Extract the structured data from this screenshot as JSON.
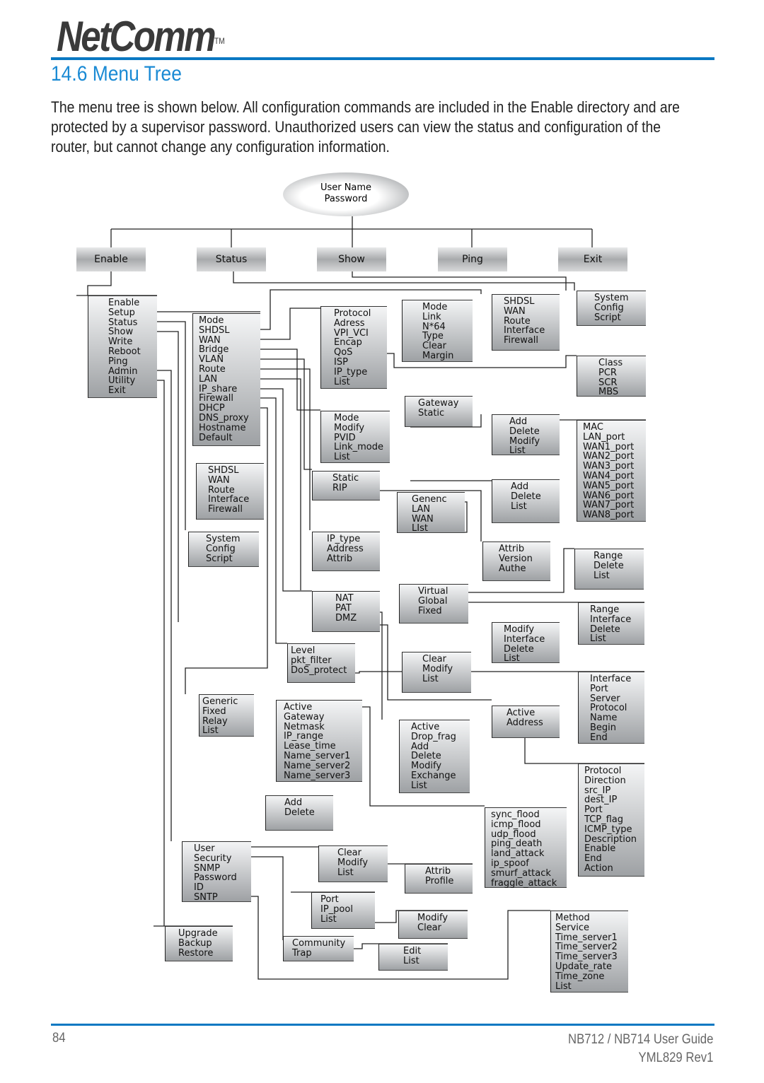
{
  "header": {
    "logo": "NetComm",
    "logo_tm": "TM",
    "accent": "#0a78c2"
  },
  "section_title": "14.6 Menu Tree",
  "intro": "The menu tree is shown below.  All configuration commands are included in the Enable directory and are protected by a supervisor password. Unauthorized users can view the status and configuration of the router, but cannot change any configuration information.",
  "diagram": {
    "root": [
      "User Name",
      "Password"
    ],
    "top_level": [
      "Enable",
      "Status",
      "Show",
      "Ping",
      "Exit"
    ],
    "boxes": [
      [
        "Enable",
        "Setup",
        "Status",
        "Show",
        "Write",
        "Reboot",
        "Ping",
        "Admin",
        "Utility",
        "Exit"
      ],
      [
        "Mode",
        "SHDSL",
        "WAN",
        "Bridge",
        "VLAN",
        "Route",
        "LAN",
        "IP_share",
        "Firewall",
        "DHCP",
        "DNS_proxy",
        "Hostname",
        "Default"
      ],
      [
        "Protocol",
        "Adress",
        "VPI_VCI",
        "Encap",
        "QoS",
        "ISP",
        "IP_type",
        "List"
      ],
      [
        "Mode",
        "Link",
        "N*64",
        "Type",
        "Clear",
        "Margin"
      ],
      [
        "SHDSL",
        "WAN",
        "Route",
        "Interface",
        "Firewall"
      ],
      [
        "System",
        "Config",
        "Script"
      ],
      [
        "Class",
        "PCR",
        "SCR",
        "MBS"
      ],
      [
        "Mode",
        "Modify",
        "PVID",
        "Link_mode",
        "List"
      ],
      [
        "Gateway",
        "Static"
      ],
      [
        "Add",
        "Delete",
        "Modify",
        "List"
      ],
      [
        "MAC",
        "LAN_port",
        "WAN1_port",
        "WAN2_port",
        "WAN3_port",
        "WAN4_port",
        "WAN5_port",
        "WAN6_port",
        "WAN7_port",
        "WAN8_port"
      ],
      [
        "Static",
        "RIP"
      ],
      [
        "Genenc",
        "LAN",
        "WAN",
        "LIst"
      ],
      [
        "Add",
        "Delete",
        "List"
      ],
      [
        "Attrib",
        "Version",
        "Authe"
      ],
      [
        "SHDSL",
        "WAN",
        "Route",
        "Interface",
        "Firewall"
      ],
      [
        "System",
        "Config",
        "Script"
      ],
      [
        "IP_type",
        "Address",
        "Attrib"
      ],
      [
        "Range",
        "Delete",
        "List"
      ],
      [
        "NAT",
        "PAT",
        "DMZ"
      ],
      [
        "Virtual",
        "Global",
        "Fixed"
      ],
      [
        "Range",
        "Interface",
        "Delete",
        "List"
      ],
      [
        "Modify",
        "Interface",
        "Delete",
        "List"
      ],
      [
        "Level",
        "pkt_filter",
        "DoS_protect"
      ],
      [
        "Clear",
        "Modify",
        "List"
      ],
      [
        "Interface",
        "Port",
        "Server",
        "Protocol",
        "Name",
        "Begin",
        "End"
      ],
      [
        "Generic",
        "Fixed",
        "Relay",
        "List"
      ],
      [
        "Active",
        "Gateway",
        "Netmask",
        "IP_range",
        "Lease_time",
        "Name_server1",
        "Name_server2",
        "Name_server3"
      ],
      [
        "Active",
        "Address"
      ],
      [
        "Active",
        "Drop_frag",
        "Add",
        "Delete",
        "Modify",
        "Exchange",
        "List"
      ],
      [
        "Protocol",
        "Direction",
        "src_IP",
        "dest_IP",
        "Port",
        "TCP_flag",
        "ICMP_type",
        "Description",
        "Enable",
        "End",
        "Action"
      ],
      [
        "Add",
        "Delete"
      ],
      [
        "sync_flood",
        "icmp_flood",
        "udp_flood",
        "ping_death",
        "land_attack",
        "ip_spoof",
        "smurf_attack",
        "fraggle_attack"
      ],
      [
        "User",
        "Security",
        "SNMP",
        "Password",
        "ID",
        "SNTP"
      ],
      [
        "Clear",
        "Modify",
        "List"
      ],
      [
        "Attrib",
        "Profile"
      ],
      [
        "Port",
        "IP_pool",
        "List"
      ],
      [
        "Modify",
        "Clear"
      ],
      [
        "Method",
        "Service",
        "Time_server1",
        "Time_server2",
        "Time_server3",
        "Update_rate",
        "Time_zone",
        "List"
      ],
      [
        "Upgrade",
        "Backup",
        "Restore"
      ],
      [
        "Community",
        "Trap"
      ],
      [
        "Edit",
        "List"
      ]
    ]
  },
  "footer": {
    "page": "84",
    "guide": "NB712 / NB714 User Guide",
    "rev": "YML829 Rev1"
  }
}
